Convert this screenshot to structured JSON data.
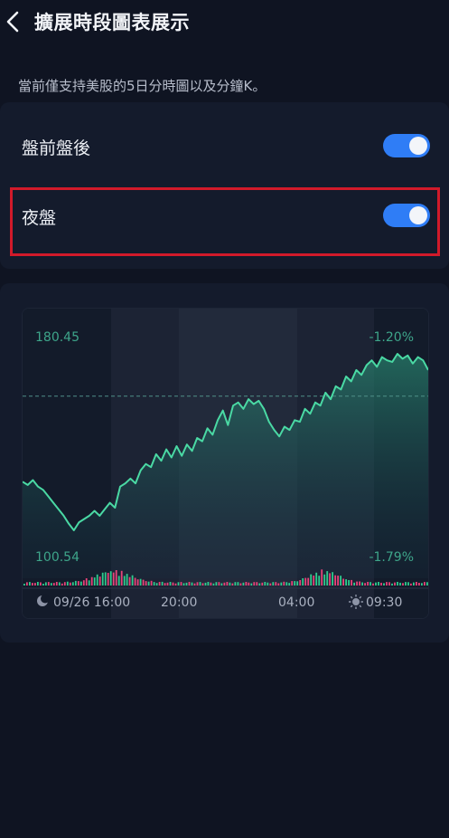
{
  "header": {
    "title": "擴展時段圖表展示"
  },
  "description": "當前僅支持美股的5日分時圖以及分鐘K。",
  "settings": [
    {
      "label": "盤前盤後",
      "enabled": true
    },
    {
      "label": "夜盤",
      "enabled": true
    }
  ],
  "chart_data": {
    "type": "area",
    "high_label": "180.45",
    "low_label": "100.54",
    "high_pct_label": "-1.20%",
    "low_pct_label": "-1.79%",
    "x_ticks": [
      "09/26 16:00",
      "20:00",
      "04:00",
      "09:30"
    ],
    "y": [
      101,
      99,
      102,
      98,
      96,
      92,
      88,
      84,
      80,
      75,
      71,
      76,
      78,
      80,
      83,
      80,
      84,
      88,
      85,
      98,
      100,
      103,
      100,
      108,
      112,
      110,
      118,
      114,
      121,
      116,
      123,
      117,
      124,
      120,
      128,
      126,
      134,
      130,
      139,
      145,
      136,
      148,
      150,
      146,
      152,
      149,
      151,
      146,
      138,
      133,
      129,
      135,
      133,
      139,
      138,
      146,
      143,
      150,
      148,
      156,
      152,
      160,
      158,
      166,
      163,
      170,
      167,
      173,
      176,
      172,
      178,
      176,
      175,
      180,
      177,
      179,
      174,
      178,
      176,
      170
    ],
    "baseline_level": 0.76,
    "colors": {
      "line": "#4ad9a4",
      "up_volume": "#2ecc8f",
      "down_volume": "#e8437a"
    }
  }
}
